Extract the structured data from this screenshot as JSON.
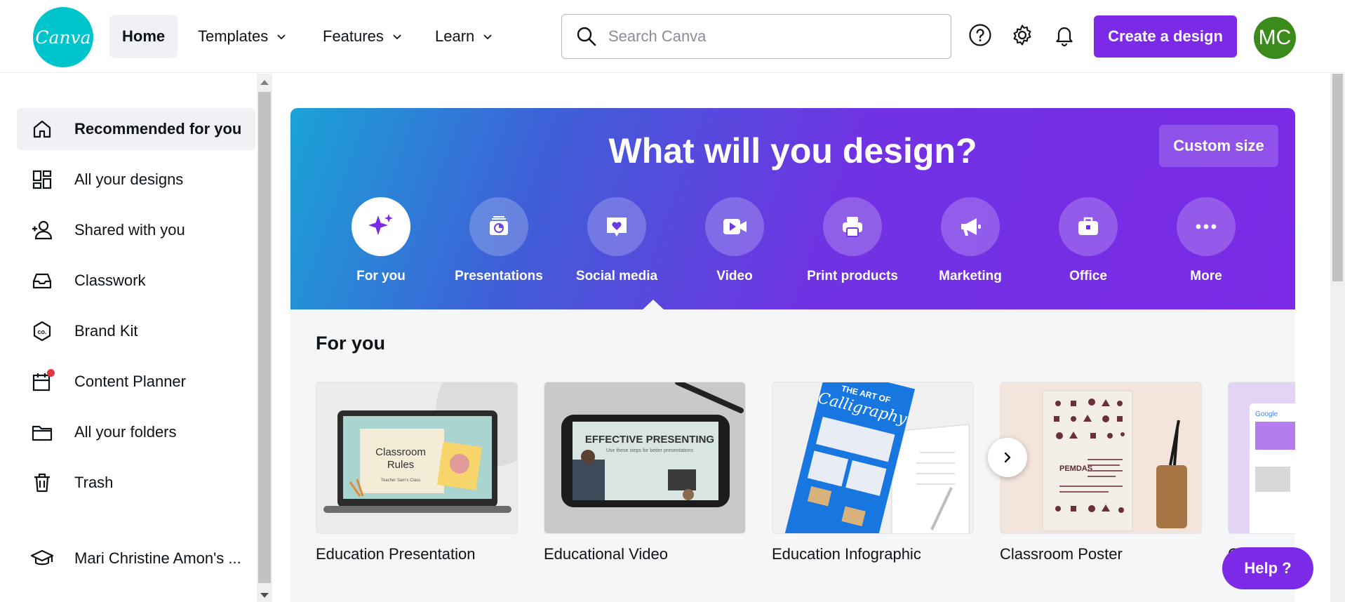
{
  "topbar": {
    "logo_text": "Canva",
    "nav": [
      {
        "label": "Home",
        "active": true
      },
      {
        "label": "Templates"
      },
      {
        "label": "Features"
      },
      {
        "label": "Learn"
      }
    ],
    "search_placeholder": "Search Canva",
    "icons": [
      "help-icon",
      "gear-icon",
      "bell-icon"
    ],
    "create_label": "Create a design",
    "avatar_initials": "MC"
  },
  "sidebar": {
    "items": [
      {
        "label": "Recommended for you",
        "icon": "home-icon",
        "active": true
      },
      {
        "label": "All your designs",
        "icon": "grid-icon"
      },
      {
        "label": "Shared with you",
        "icon": "users-icon"
      },
      {
        "label": "Classwork",
        "icon": "inbox-icon"
      },
      {
        "label": "Brand Kit",
        "icon": "brand-kit-icon"
      },
      {
        "label": "Content Planner",
        "icon": "calendar-icon"
      },
      {
        "label": "All your folders",
        "icon": "folder-icon"
      },
      {
        "label": "Trash",
        "icon": "trash-icon"
      }
    ],
    "team_label": "Mari Christine Amon's ..."
  },
  "hero": {
    "title": "What will you design?",
    "custom_size_label": "Custom size",
    "categories": [
      {
        "label": "For you",
        "icon": "sparkle-icon",
        "active": true
      },
      {
        "label": "Presentations",
        "icon": "presentation-icon"
      },
      {
        "label": "Social media",
        "icon": "heart-icon"
      },
      {
        "label": "Video",
        "icon": "video-icon"
      },
      {
        "label": "Print products",
        "icon": "printer-icon"
      },
      {
        "label": "Marketing",
        "icon": "megaphone-icon"
      },
      {
        "label": "Office",
        "icon": "briefcase-icon"
      },
      {
        "label": "More",
        "icon": "more-icon"
      }
    ]
  },
  "foryou": {
    "title": "For you",
    "cards": [
      {
        "caption": "Education Presentation",
        "thumb_text": [
          "Classroom",
          "Rules",
          "Teacher Sam's Class"
        ]
      },
      {
        "caption": "Educational Video",
        "thumb_text": [
          "EFFECTIVE PRESENTING",
          "Use these steps for better presentations"
        ]
      },
      {
        "caption": "Education Infographic",
        "thumb_text": [
          "THE ART OF",
          "Calligraphy"
        ]
      },
      {
        "caption": "Classroom Poster",
        "thumb_text": [
          "PEMDAS"
        ]
      },
      {
        "caption": "C",
        "thumb_text": [
          "Google"
        ]
      }
    ]
  },
  "help_label": "Help ?",
  "colors": {
    "brand_purple": "#7d2ae8",
    "logo_teal": "#00c4cc",
    "avatar_green": "#3a8b1b"
  }
}
